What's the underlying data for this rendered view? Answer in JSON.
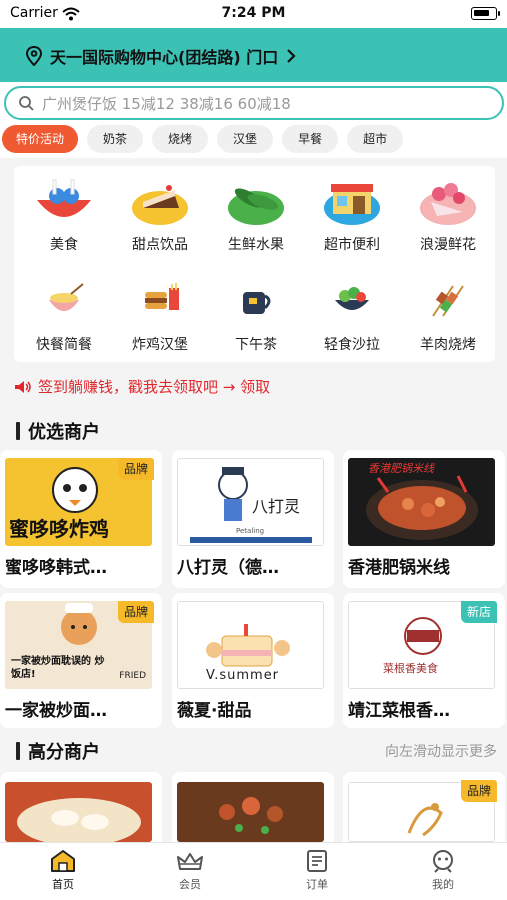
{
  "status_bar": {
    "carrier": "Carrier",
    "time": "7:24 PM"
  },
  "header": {
    "location": "天一国际购物中心(团结路) 门口",
    "brand_color": "#3cc1b5"
  },
  "search": {
    "placeholder": "广州煲仔饭 15减12 38减16 60减18"
  },
  "chips": [
    {
      "label": "特价活动",
      "active": true
    },
    {
      "label": "奶茶"
    },
    {
      "label": "烧烤"
    },
    {
      "label": "汉堡"
    },
    {
      "label": "早餐"
    },
    {
      "label": "超市"
    }
  ],
  "categories": [
    {
      "label": "美食",
      "icon": "food-icon"
    },
    {
      "label": "甜点饮品",
      "icon": "cake-icon"
    },
    {
      "label": "生鲜水果",
      "icon": "cucumber-icon"
    },
    {
      "label": "超市便利",
      "icon": "store-icon"
    },
    {
      "label": "浪漫鲜花",
      "icon": "flower-icon"
    },
    {
      "label": "快餐简餐",
      "icon": "bowl-icon"
    },
    {
      "label": "炸鸡汉堡",
      "icon": "burger-icon"
    },
    {
      "label": "下午茶",
      "icon": "tea-icon"
    },
    {
      "label": "轻食沙拉",
      "icon": "salad-icon"
    },
    {
      "label": "羊肉烧烤",
      "icon": "skewer-icon"
    }
  ],
  "notice": {
    "text": "签到躺赚钱，戳我去领取吧 → 领取"
  },
  "featured": {
    "title": "优选商户",
    "merchants": [
      {
        "name": "蜜哆哆韩式…",
        "tag": "品牌",
        "thumb_text": "蜜哆哆炸鸡"
      },
      {
        "name": "八打灵（德…",
        "tag": "",
        "thumb_text": "八打灵",
        "thumb_sub": "Petaling"
      },
      {
        "name": "香港肥锅米线",
        "tag": "",
        "thumb_text": "香港肥锅米线"
      },
      {
        "name": "一家被炒面…",
        "tag": "品牌",
        "thumb_text": "一家被炒面耽误的 炒饭店!",
        "thumb_sub": "FRIED"
      },
      {
        "name": "薇夏·甜品",
        "tag": "",
        "thumb_text": "V.summer"
      },
      {
        "name": "靖江菜根香…",
        "tag": "新店",
        "thumb_text": "菜根香美食"
      }
    ]
  },
  "top_rated": {
    "title": "高分商户",
    "hint": "向左滑动显示更多",
    "merchants": [
      {
        "tag": ""
      },
      {
        "tag": ""
      },
      {
        "tag": "品牌"
      }
    ]
  },
  "tabbar": [
    {
      "label": "首页",
      "icon": "home-icon",
      "active": true
    },
    {
      "label": "会员",
      "icon": "crown-icon"
    },
    {
      "label": "订单",
      "icon": "order-icon"
    },
    {
      "label": "我的",
      "icon": "profile-icon"
    }
  ]
}
